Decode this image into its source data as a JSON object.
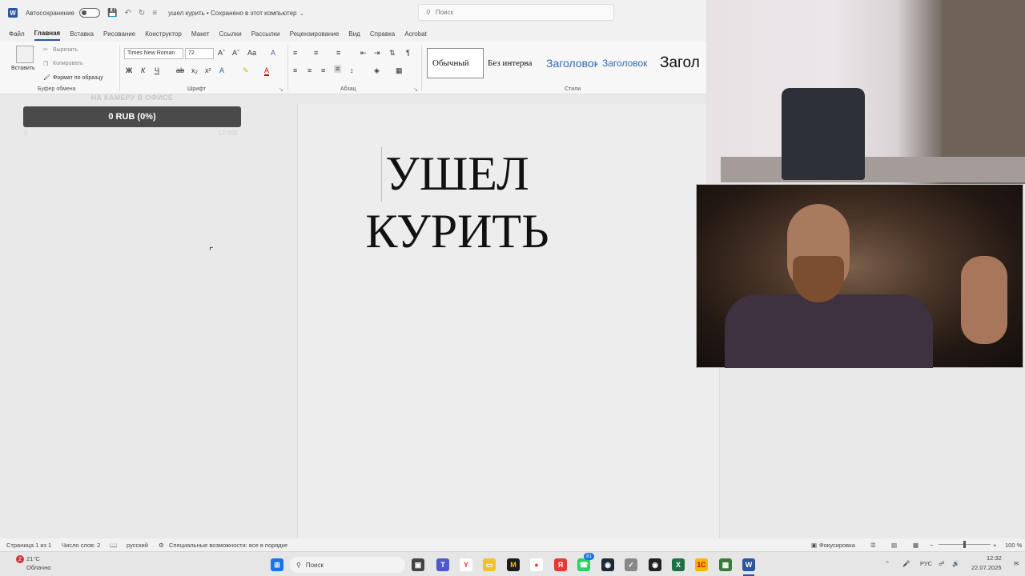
{
  "titlebar": {
    "autosave_label": "Автосохранение",
    "doc_title": "ушел курить • Сохранено в этот компьютер",
    "search_placeholder": "Поиск"
  },
  "menu": {
    "tabs": [
      "Файл",
      "Главная",
      "Вставка",
      "Рисование",
      "Конструктор",
      "Макет",
      "Ссылки",
      "Рассылки",
      "Рецензирование",
      "Вид",
      "Справка",
      "Acrobat"
    ]
  },
  "ribbon": {
    "clipboard": {
      "paste": "Вставить",
      "cut": "Вырезать",
      "copy": "Копировать",
      "format_painter": "Формат по образцу",
      "label": "Буфер обмена"
    },
    "font": {
      "name": "Times New Roman",
      "size": "72",
      "label": "Шрифт",
      "bold": "Ж",
      "italic": "К",
      "underline": "Ч"
    },
    "paragraph": {
      "label": "Абзац"
    },
    "styles": {
      "label": "Стили",
      "items": [
        "Обычный",
        "Без интерва",
        "Заголовок",
        "Заголовок",
        "Загол"
      ]
    }
  },
  "widget": {
    "title": "НА КАМЕРУ В ОФИСЕ",
    "progress_text": "0 RUB (0%)",
    "progress_fraction": 0,
    "min": "0",
    "max": "12 000"
  },
  "document": {
    "line1": "УШЕЛ",
    "line2": "КУРИТЬ"
  },
  "statusbar": {
    "page": "Страница 1 из 1",
    "words": "Число слов: 2",
    "language": "русский",
    "accessibility": "Специальные возможности: все в порядке",
    "focus": "Фокусировка",
    "zoom": "100 %"
  },
  "taskbar": {
    "weather_temp": "21°C",
    "weather_desc": "Облачно",
    "search": "Поиск",
    "lang": "РУС",
    "time": "12:32",
    "date": "22.07.2025",
    "notification_count": "2",
    "messenger_badge": "81"
  },
  "colors": {
    "word_blue": "#2b579a",
    "heading_blue": "#2f6bb3",
    "excel_green": "#1e7145"
  }
}
